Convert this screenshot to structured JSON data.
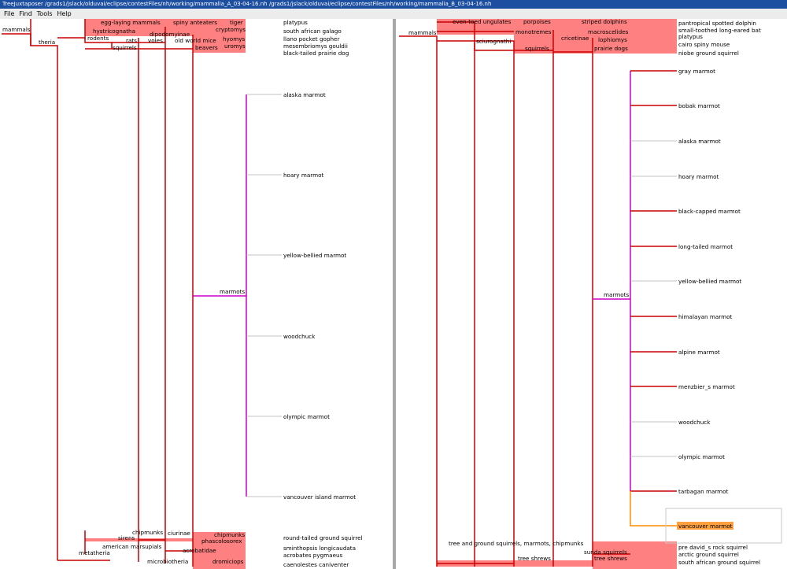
{
  "window": {
    "title": "TreeJuxtaposer /grads1/jslack/olduvai/eclipse/contestFiles/nh/working/mammalia_A_03-04-16.nh  /grads1/jslack/olduvai/eclipse/contestFiles/nh/working/mammalia_B_03-04-16.nh"
  },
  "menu": {
    "file": "File",
    "find": "Find",
    "tools": "Tools",
    "help": "Help"
  },
  "colors": {
    "edge": "#cc0000",
    "marmot_edge": "#cc00cc",
    "highlight": "#ff8080",
    "selected": "#ffa040",
    "title_bar": "#1c4fa0"
  },
  "left": {
    "internal": {
      "mammals": "mammals",
      "theria": "theria",
      "egg_laying": "egg-laying mammals",
      "spiny": "spiny anteaters",
      "tiger": "tiger",
      "hystricognatha": "hystricognatha",
      "cryptomys": "cryptomys",
      "dipodomyinae": "dipodomyinae",
      "rodents": "rodents",
      "rats": "rats",
      "voles": "voles",
      "old_world_mice": "old world mice",
      "hyomys": "hyomys",
      "squirrels": "squirrels",
      "beavers": "beavers",
      "uromys": "uromys",
      "marmots": "marmots",
      "chipmunks_ciur": "chipmunks",
      "ciurinae": "ciurinae",
      "sirens": "sirens",
      "chipmunks2": "chipmunks",
      "american_marsupials": "american marsupials",
      "phascolosorex": "phascolosorex",
      "acrobatidae": "acrobatidae",
      "metatheria": "metatheria",
      "microbiotheria": "microbiotheria",
      "dromiciops": "dromiciops"
    },
    "leaves": {
      "platypus": "platypus",
      "south_african_galago": "south african galago",
      "llano": "llano pocket gopher",
      "mesembriomys": "mesembriomys gouldii",
      "black_tailed": "black-tailed prairie dog",
      "alaska": "alaska marmot",
      "hoary": "hoary marmot",
      "yellow_bellied": "yellow-bellied marmot",
      "woodchuck": "woodchuck",
      "olympic": "olympic marmot",
      "vancouver": "vancouver island marmot",
      "round_tailed": "round-tailed ground squirrel",
      "sminthopsis": "sminthopsis longicaudata",
      "acrobates": "acrobates pygmaeus",
      "caenolestes": "caenolestes caniventer"
    }
  },
  "right": {
    "internal": {
      "mammals": "mammals",
      "even_toed": "even-toed ungulates",
      "porpoises": "porpoises",
      "striped": "striped dolphins",
      "monotremes": "monotremes",
      "macroscelides": "macroscelides",
      "sciurognathi": "sciurognathi",
      "cricetinae": "cricetinae",
      "lophiomys": "lophiomys",
      "squirrels": "squirrels",
      "prairie_dogs": "prairie dogs",
      "marmots": "marmots",
      "tree_ground": "tree and ground squirrels, marmots, chipmunks",
      "sunda_squirrels": "sunda squirrels",
      "tree_shrews": "tree shrews",
      "tree_shrews2": "tree shrews"
    },
    "leaves": {
      "pantropical": "pantropical spotted dolphin",
      "small_toothed": "small-toothed long-eared bat",
      "platypus": "platypus",
      "cairo": "cairo spiny mouse",
      "niobe": "niobe ground squirrel",
      "gray": "gray marmot",
      "bobak": "bobak marmot",
      "alaska": "alaska marmot",
      "hoary": "hoary marmot",
      "black_capped": "black-capped marmot",
      "long_tailed": "long-tailed marmot",
      "yellow_bellied": "yellow-bellied marmot",
      "himalayan": "himalayan marmot",
      "alpine": "alpine marmot",
      "menzbier": "menzbier_s marmot",
      "woodchuck": "woodchuck",
      "olympic": "olympic marmot",
      "tarbagan": "tarbagan marmot",
      "vancouver": "vancouver marmot",
      "pre_david": "pre david_s rock squirrel",
      "arctic": "arctic ground squirrel",
      "south_african_gs": "south african ground squirrel"
    }
  }
}
